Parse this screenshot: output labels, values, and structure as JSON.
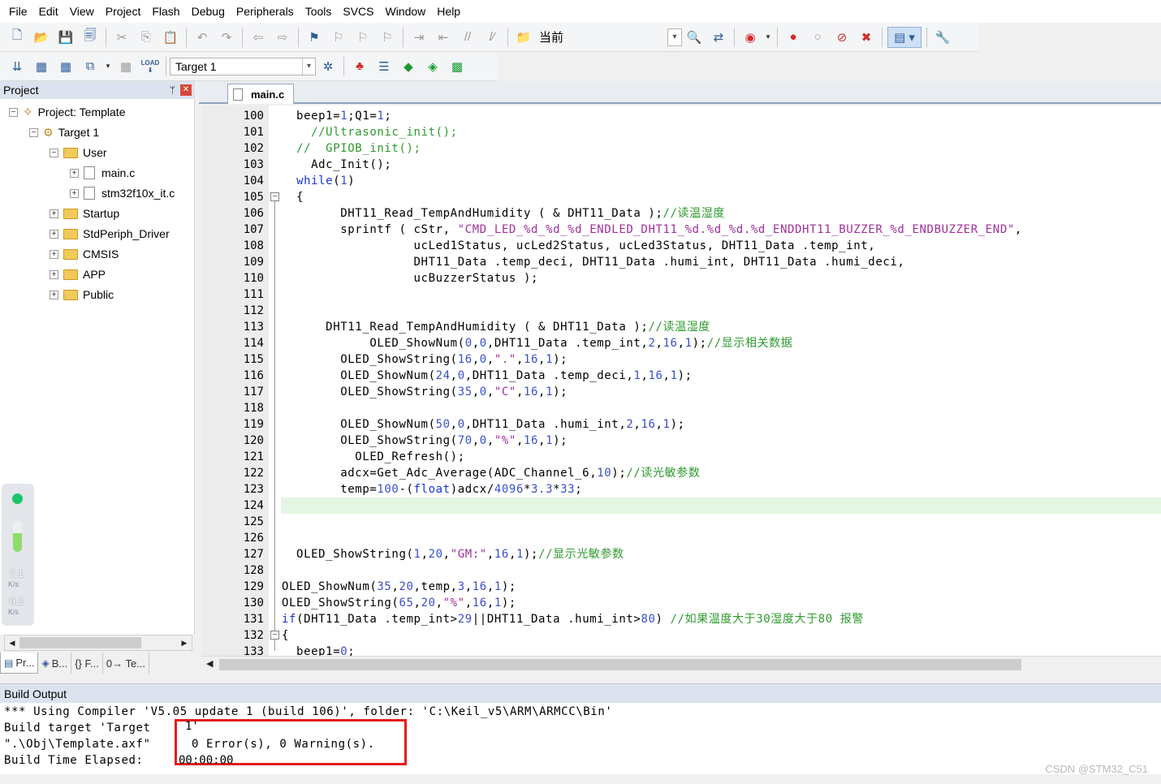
{
  "menu": [
    "File",
    "Edit",
    "View",
    "Project",
    "Flash",
    "Debug",
    "Peripherals",
    "Tools",
    "SVCS",
    "Window",
    "Help"
  ],
  "toolbar1": {
    "find_text": "当前"
  },
  "toolbar2": {
    "target": "Target 1",
    "load_label": "LOAD"
  },
  "project": {
    "title": "Project",
    "pin": "ᛘ",
    "close": "✕",
    "root": "Project: Template",
    "target": "Target 1",
    "groups": {
      "user": "User",
      "files": [
        "main.c",
        "stm32f10x_it.c"
      ],
      "startup": "Startup",
      "stdperiph": "StdPeriph_Driver",
      "cmsis": "CMSIS",
      "app": "APP",
      "public": "Public"
    },
    "tabs": [
      "Pr...",
      "B...",
      "{} F...",
      "0→ Te..."
    ]
  },
  "gadget": {
    "up": "7.1",
    "up_unit": "K/s",
    "down": "0.2",
    "down_unit": "K/s"
  },
  "editor": {
    "tab": "main.c",
    "lines": [
      {
        "n": "100",
        "t": "  beep1=1;Q1=1;"
      },
      {
        "n": "101",
        "t": "    //Ultrasonic_init();"
      },
      {
        "n": "102",
        "t": "  //  GPIOB_init();"
      },
      {
        "n": "103",
        "t": "    Adc_Init();"
      },
      {
        "n": "104",
        "t": "  while(1)"
      },
      {
        "n": "105",
        "t": "  {"
      },
      {
        "n": "106",
        "t": "        DHT11_Read_TempAndHumidity ( & DHT11_Data );//读温湿度"
      },
      {
        "n": "107",
        "t": "        sprintf ( cStr, \"CMD_LED_%d_%d_%d_ENDLED_DHT11_%d.%d_%d.%d_ENDDHT11_BUZZER_%d_ENDBUZZER_END\","
      },
      {
        "n": "108",
        "t": "                  ucLed1Status, ucLed2Status, ucLed3Status, DHT11_Data .temp_int,"
      },
      {
        "n": "109",
        "t": "                  DHT11_Data .temp_deci, DHT11_Data .humi_int, DHT11_Data .humi_deci,"
      },
      {
        "n": "110",
        "t": "                  ucBuzzerStatus );"
      },
      {
        "n": "111",
        "t": ""
      },
      {
        "n": "112",
        "t": ""
      },
      {
        "n": "113",
        "t": "      DHT11_Read_TempAndHumidity ( & DHT11_Data );//读温湿度"
      },
      {
        "n": "114",
        "t": "            OLED_ShowNum(0,0,DHT11_Data .temp_int,2,16,1);//显示相关数据"
      },
      {
        "n": "115",
        "t": "        OLED_ShowString(16,0,\".\",16,1);"
      },
      {
        "n": "116",
        "t": "        OLED_ShowNum(24,0,DHT11_Data .temp_deci,1,16,1);"
      },
      {
        "n": "117",
        "t": "        OLED_ShowString(35,0,\"C\",16,1);"
      },
      {
        "n": "118",
        "t": ""
      },
      {
        "n": "119",
        "t": "        OLED_ShowNum(50,0,DHT11_Data .humi_int,2,16,1);"
      },
      {
        "n": "120",
        "t": "        OLED_ShowString(70,0,\"%\",16,1);"
      },
      {
        "n": "121",
        "t": "          OLED_Refresh();"
      },
      {
        "n": "122",
        "t": "        adcx=Get_Adc_Average(ADC_Channel_6,10);//读光敏参数"
      },
      {
        "n": "123",
        "t": "        temp=100-(float)adcx/4096*3.3*33;"
      },
      {
        "n": "124",
        "t": ""
      },
      {
        "n": "125",
        "t": ""
      },
      {
        "n": "126",
        "t": ""
      },
      {
        "n": "127",
        "t": "  OLED_ShowString(1,20,\"GM:\",16,1);//显示光敏参数"
      },
      {
        "n": "128",
        "t": ""
      },
      {
        "n": "129",
        "t": "OLED_ShowNum(35,20,temp,3,16,1);"
      },
      {
        "n": "130",
        "t": "OLED_ShowString(65,20,\"%\",16,1);"
      },
      {
        "n": "131",
        "t": "if(DHT11_Data .temp_int>29||DHT11_Data .humi_int>80) //如果温度大于30湿度大于80 报警"
      },
      {
        "n": "132",
        "t": "{"
      },
      {
        "n": "133",
        "t": "  beep1=0;"
      }
    ]
  },
  "build_output": {
    "title": "Build Output",
    "line1": "*** Using Compiler 'V5.05 update 1 (build 106)', folder: 'C:\\Keil_v5\\ARM\\ARMCC\\Bin'",
    "line2": "Build target 'Target ",
    "line3": "\".\\Obj\\Template.axf\" ",
    "line4": "Build Time Elapsed:  ",
    "result": "0 Error(s), 0 Warning(s).",
    "frag_top": "1'",
    "frag_bottom": "00:00:00"
  },
  "watermark": "CSDN @STM32_C51",
  "colors": {
    "comment": "#2e9a2e",
    "keyword": "#1a34d0",
    "number": "#3a50c8",
    "string": "#a0309a",
    "current_line": "#e3f6e3",
    "error_box": "#e21c1c"
  }
}
